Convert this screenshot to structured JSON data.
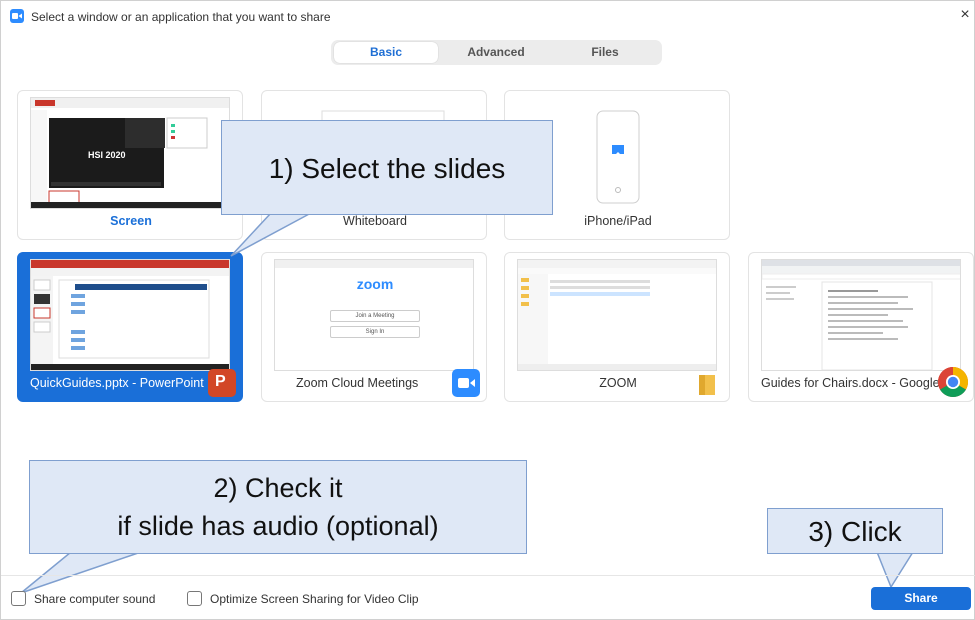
{
  "window": {
    "title": "Select a window or an application that you want to share",
    "close_glyph": "×"
  },
  "tabs": [
    {
      "label": "Basic",
      "active": true
    },
    {
      "label": "Advanced",
      "active": false
    },
    {
      "label": "Files",
      "active": false
    }
  ],
  "tiles": [
    {
      "label": "Screen",
      "icon": "screen-thumb",
      "selected": false
    },
    {
      "label": "Whiteboard",
      "icon": "whiteboard-thumb",
      "selected": false
    },
    {
      "label": "iPhone/iPad",
      "icon": "phone-icon",
      "selected": false
    },
    {
      "label": "QuickGuides.pptx - PowerPoint",
      "icon": "powerpoint-icon",
      "selected": true
    },
    {
      "label": "Zoom Cloud Meetings",
      "icon": "zoom-icon",
      "selected": false
    },
    {
      "label": "ZOOM",
      "icon": "folder-icon",
      "selected": false
    },
    {
      "label": "Guides for Chairs.docx - Google ...",
      "icon": "chrome-icon",
      "selected": false
    }
  ],
  "thumb_text": {
    "screen_slide_title": "HSI 2020",
    "zoom_logo": "zoom",
    "zoom_join": "Join a Meeting",
    "zoom_signin": "Sign In",
    "powerpoint_letter": "P"
  },
  "callouts": {
    "step1": "1) Select the slides",
    "step2_line1": "2) Check it",
    "step2_line2": "if slide has audio (optional)",
    "step3": "3) Click"
  },
  "footer": {
    "share_sound_label": "Share computer sound",
    "optimize_label": "Optimize Screen Sharing for Video Clip",
    "share_button": "Share",
    "share_sound_checked": false,
    "optimize_checked": false
  },
  "colors": {
    "accent": "#1a6fd8",
    "callout_fill": "#dfe8f6",
    "callout_border": "#7f9fcf"
  }
}
